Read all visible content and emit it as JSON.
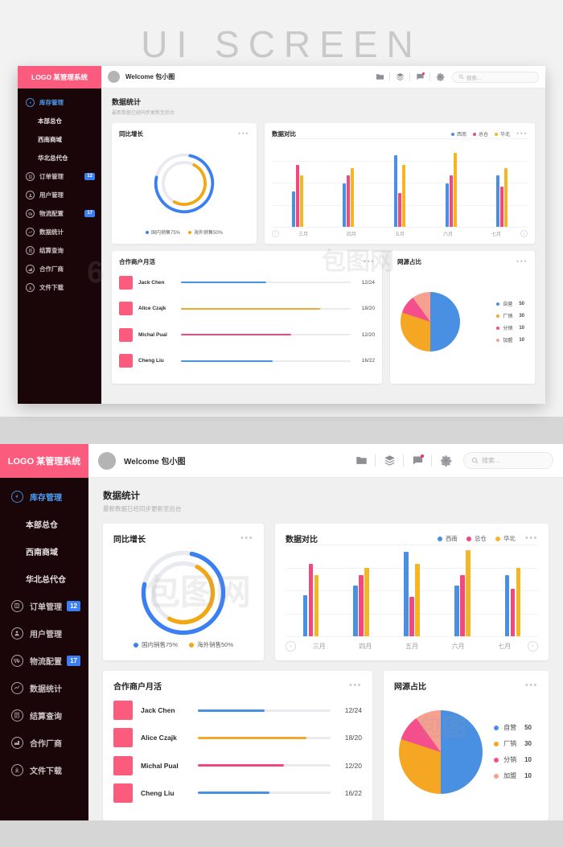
{
  "watermark_title": "UI SCREEN",
  "brand": {
    "logo_text": "LOGO 某管理系统",
    "pink": "#fb5c7e",
    "sidebar_bg": "#1a0608",
    "active_blue": "#4d9ff5",
    "badge_blue": "#3b7ff2"
  },
  "sidebar": {
    "items": [
      {
        "label": "库存管理",
        "icon": "compass-icon",
        "active": true,
        "sub": false,
        "badge": ""
      },
      {
        "label": "本部总仓",
        "icon": "",
        "active": false,
        "sub": true,
        "badge": ""
      },
      {
        "label": "西南商域",
        "icon": "",
        "active": false,
        "sub": true,
        "badge": ""
      },
      {
        "label": "华北总代仓",
        "icon": "",
        "active": false,
        "sub": true,
        "badge": ""
      },
      {
        "label": "订单管理",
        "icon": "list-icon",
        "active": false,
        "sub": false,
        "badge": "12"
      },
      {
        "label": "用户管理",
        "icon": "user-icon",
        "active": false,
        "sub": false,
        "badge": ""
      },
      {
        "label": "物流配置",
        "icon": "truck-icon",
        "active": false,
        "sub": false,
        "badge": "17"
      },
      {
        "label": "数据统计",
        "icon": "chart-icon",
        "active": false,
        "sub": false,
        "badge": ""
      },
      {
        "label": "结算查询",
        "icon": "invoice-icon",
        "active": false,
        "sub": false,
        "badge": ""
      },
      {
        "label": "合作厂商",
        "icon": "factory-icon",
        "active": false,
        "sub": false,
        "badge": ""
      },
      {
        "label": "文件下载",
        "icon": "download-icon",
        "active": false,
        "sub": false,
        "badge": ""
      }
    ]
  },
  "topbar": {
    "welcome": "Welcome 包小图",
    "icons": [
      "folder-icon",
      "layers-icon",
      "message-icon",
      "gear-icon"
    ],
    "search_placeholder": "搜索..."
  },
  "section": {
    "title": "数据统计",
    "subtitle": "最新数据已经同步更新至后台"
  },
  "cards": {
    "donut": {
      "title": "同比增长",
      "menu": "•••"
    },
    "bars": {
      "title": "数据对比",
      "menu": "•••"
    },
    "partners": {
      "title": "合作商户月活",
      "menu": "•••"
    },
    "pie": {
      "title": "网源占比",
      "menu": "•••"
    }
  },
  "chart_data": [
    {
      "type": "pie",
      "id": "donut-growth",
      "title": "同比增长",
      "legend_position": "bottom",
      "series": [
        {
          "name": "国内销售75%",
          "label": "国内销售75%",
          "value": 75,
          "color": "#3b7ff2",
          "ring": "outer"
        },
        {
          "name": "海外销售50%",
          "label": "海外销售50%",
          "value": 50,
          "color": "#f3a712",
          "ring": "inner"
        }
      ],
      "track_color": "#e8eaef"
    },
    {
      "type": "bar",
      "id": "data-compare",
      "title": "数据对比",
      "categories": [
        "三月",
        "四月",
        "五月",
        "六月",
        "七月"
      ],
      "series": [
        {
          "name": "西南",
          "color": "#4a90e2",
          "values": [
            42,
            52,
            86,
            52,
            62
          ]
        },
        {
          "name": "总仓",
          "color": "#f0487f",
          "values": [
            74,
            62,
            40,
            62,
            48
          ]
        },
        {
          "name": "华北",
          "color": "#f5b623",
          "values": [
            62,
            70,
            74,
            88,
            70
          ]
        }
      ],
      "ylim": [
        0,
        100
      ],
      "grid": true,
      "prev_label": "‹",
      "next_label": "›"
    },
    {
      "type": "bar",
      "id": "partner-monthly-active",
      "title": "合作商户月活",
      "orientation": "horizontal",
      "categories": [
        "Jack Chen",
        "Alice Czajk",
        "Michal Pual",
        "Cheng Liu"
      ],
      "values": [
        12,
        18,
        12,
        16
      ],
      "totals": [
        24,
        20,
        20,
        22
      ],
      "value_labels": [
        "12/24",
        "18/20",
        "12/20",
        "16/22"
      ],
      "colors": [
        "#4a90e2",
        "#f0a830",
        "#f0487f",
        "#4a90e2"
      ],
      "track_color": "#eaeaee"
    },
    {
      "type": "pie",
      "id": "source-share",
      "title": "网源占比",
      "legend_position": "right",
      "labels": [
        "自营",
        "厂销",
        "分销",
        "加盟"
      ],
      "values": [
        50,
        30,
        10,
        10
      ],
      "colors": [
        "#4a90e2",
        "#f5a623",
        "#f54e8c",
        "#f8a08f"
      ]
    }
  ],
  "partners": [
    {
      "name": "Jack Chen",
      "value": "12/24",
      "pct": 50,
      "color": "#4a90e2"
    },
    {
      "name": "Alice Czajk",
      "value": "18/20",
      "pct": 82,
      "color": "#f0a830"
    },
    {
      "name": "Michal Pual",
      "value": "12/20",
      "pct": 65,
      "color": "#f0487f"
    },
    {
      "name": "Cheng Liu",
      "value": "16/22",
      "pct": 54,
      "color": "#4a90e2"
    }
  ]
}
